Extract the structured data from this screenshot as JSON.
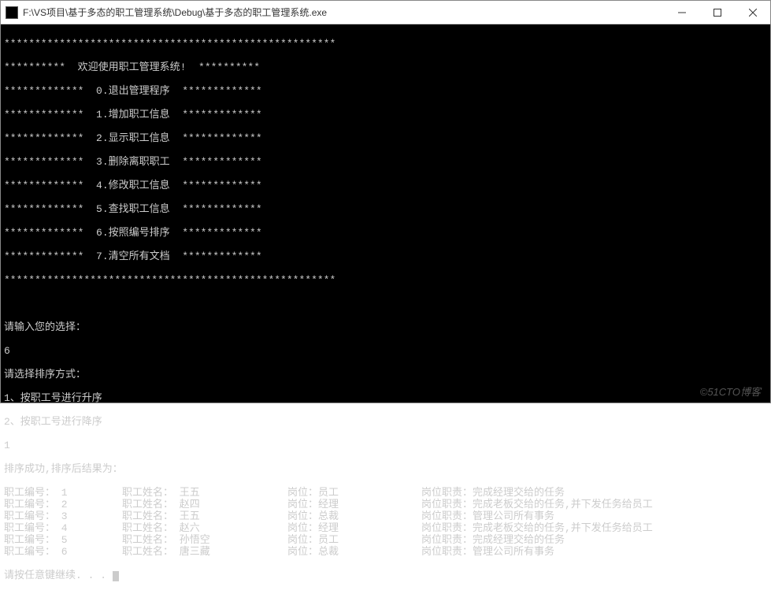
{
  "titlebar": {
    "icon_name": "console-icon",
    "path": "F:\\VS项目\\基于多态的职工管理系统\\Debug\\基于多态的职工管理系统.exe"
  },
  "banner": {
    "line0": "******************************************************",
    "line1": "**********  欢迎使用职工管理系统!  **********",
    "menu": [
      "*************  0.退出管理程序  *************",
      "*************  1.增加职工信息  *************",
      "*************  2.显示职工信息  *************",
      "*************  3.删除离职职工  *************",
      "*************  4.修改职工信息  *************",
      "*************  5.查找职工信息  *************",
      "*************  6.按照编号排序  *************",
      "*************  7.清空所有文档  *************"
    ],
    "line_end": "******************************************************"
  },
  "prompts": {
    "choose": "请输入您的选择：",
    "choice": "6",
    "sort_title": "请选择排序方式：",
    "sort_opt1": "1、按职工号进行升序",
    "sort_opt2": "2、按职工号进行降序",
    "sort_choice": "1",
    "result_title": "排序成功,排序后结果为：",
    "continue": "请按任意键继续. . . "
  },
  "labels": {
    "id": "职工编号：",
    "name": "职工姓名：",
    "pos": "岗位：",
    "duty": "岗位职责："
  },
  "rows": [
    {
      "id": "1",
      "name": "王五",
      "pos": "员工",
      "duty": "完成经理交给的任务"
    },
    {
      "id": "2",
      "name": "赵四",
      "pos": "经理",
      "duty": "完成老板交给的任务,并下发任务给员工"
    },
    {
      "id": "3",
      "name": "王五",
      "pos": "总裁",
      "duty": "管理公司所有事务"
    },
    {
      "id": "4",
      "name": "赵六",
      "pos": "经理",
      "duty": "完成老板交给的任务,并下发任务给员工"
    },
    {
      "id": "5",
      "name": "孙悟空",
      "pos": "员工",
      "duty": "完成经理交给的任务"
    },
    {
      "id": "6",
      "name": "唐三藏",
      "pos": "总裁",
      "duty": "管理公司所有事务"
    }
  ],
  "watermark": "©51CTO博客"
}
